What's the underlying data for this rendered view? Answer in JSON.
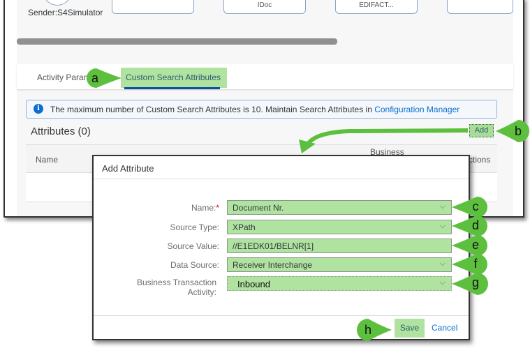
{
  "background": {
    "sender": "Sender:S4Simulator",
    "cards": [
      "",
      "IDoc",
      "EDIFACT...",
      ""
    ],
    "tabs": [
      {
        "label": "Activity Parameters"
      },
      {
        "label": "Custom Search Attributes",
        "selected": true
      }
    ],
    "info": {
      "text": "The maximum number of Custom Search Attributes is 10. Maintain Search Attributes in ",
      "link": "Configuration Manager"
    },
    "attributes_title": "Attributes (0)",
    "add_label": "Add",
    "columns": [
      "Name",
      "Business",
      "Actions"
    ]
  },
  "dialog": {
    "title": "Add Attribute",
    "fields": [
      {
        "label": "Name:",
        "required": true,
        "value": "Document Nr.",
        "type": "select"
      },
      {
        "label": "Source Type:",
        "value": "XPath",
        "type": "select"
      },
      {
        "label": "Source Value:",
        "value": "//E1EDK01/BELNR[1]",
        "type": "text"
      },
      {
        "label": "Data Source:",
        "value": "Receiver Interchange",
        "type": "select"
      },
      {
        "label": "Business Transaction Activity:",
        "value": "Inbound",
        "type": "select"
      }
    ],
    "save_label": "Save",
    "cancel_label": "Cancel"
  },
  "markers": [
    "a",
    "b",
    "c",
    "d",
    "e",
    "f",
    "g",
    "h"
  ],
  "colors": {
    "highlight": "#b0e3a0",
    "marker": "#5dbf3e",
    "link": "#0a6ed1"
  }
}
